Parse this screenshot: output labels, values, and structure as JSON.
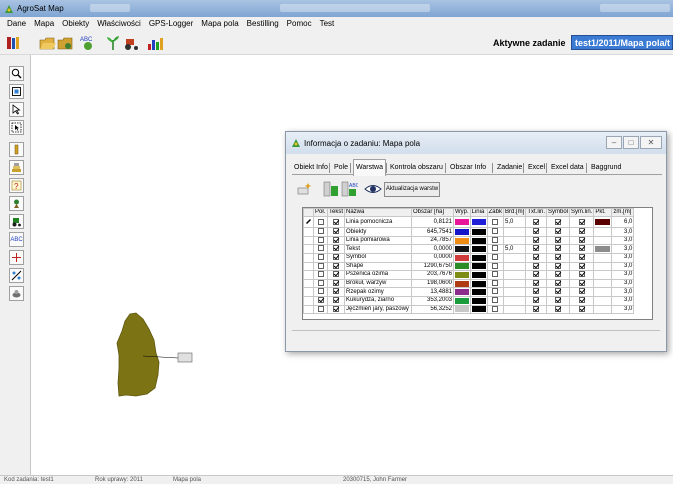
{
  "window": {
    "title": "AgroSat Map"
  },
  "menu": [
    "Dane",
    "Mapa",
    "Obiekty",
    "Właściwości",
    "GPS-Logger",
    "Mapa pola",
    "Bestilling",
    "Pomoc",
    "Test"
  ],
  "toolbar": {
    "active_task_label": "Aktywne zadanie",
    "active_task_value": "test1/2011/Mapa pola/t"
  },
  "left_tools": [
    "zoom-icon",
    "zoom-extent-icon",
    "select-arrow-icon",
    "select-region-icon",
    "measure-icon",
    "layer-icon",
    "info-icon",
    "gps-icon",
    "tractor-icon",
    "text-label-icon",
    "vertex-icon",
    "split-icon",
    "soil-icon"
  ],
  "left_tool_abc_label": "ABC",
  "map": {
    "field_label": ""
  },
  "dialog": {
    "title": "Informacja o zadaniu: Mapa pola",
    "tabs": [
      "Obiekt Info",
      "Pole",
      "Warstwa",
      "Kontrola obszaru",
      "Obszar Info",
      "Zadanie",
      "Excel",
      "Excel data",
      "Baggrund"
    ],
    "active_tab": "Warstwa",
    "update_button": "Aktualizacja warstw",
    "columns": [
      "Poł.",
      "Tekst",
      "Nazwa",
      "Obszar [ha]",
      "Wyp.",
      "Linia",
      "Zabk",
      "Brd.[m]",
      "Txt.lin.",
      "Symbol",
      "Sym.lin.",
      "Pkt.",
      "zm.[m]"
    ],
    "rows": [
      {
        "pol": false,
        "tekst": true,
        "name": "Linia pomocnicza",
        "area": "0,8121",
        "fill": "#e8149a",
        "line": "#1f1fd8",
        "zabk": false,
        "brd": "5,0",
        "txt": true,
        "sym": true,
        "symlin": true,
        "pkt": "#5a0000",
        "zm": "6,0",
        "selected": true
      },
      {
        "pol": false,
        "tekst": true,
        "name": "Obiekty",
        "area": "645,7541",
        "fill": "#1414c8",
        "line": "#000000",
        "zabk": false,
        "brd": "",
        "txt": true,
        "sym": true,
        "symlin": true,
        "pkt": "",
        "zm": "3,0",
        "selected": false
      },
      {
        "pol": false,
        "tekst": true,
        "name": "Linia pomiarowa",
        "area": "24,7857",
        "fill": "#f08c14",
        "line": "#000000",
        "zabk": false,
        "brd": "",
        "txt": true,
        "sym": true,
        "symlin": true,
        "pkt": "",
        "zm": "3,0",
        "selected": false
      },
      {
        "pol": false,
        "tekst": true,
        "name": "Tekst",
        "area": "0,0000",
        "fill": "#141414",
        "line": "#000000",
        "zabk": false,
        "brd": "5,0",
        "txt": true,
        "sym": true,
        "symlin": true,
        "pkt": "#8c8c8c",
        "zm": "3,0",
        "selected": false
      },
      {
        "pol": false,
        "tekst": true,
        "name": "Symbol",
        "area": "0,0000",
        "fill": "#d03c3c",
        "line": "#000000",
        "zabk": false,
        "brd": "",
        "txt": true,
        "sym": true,
        "symlin": true,
        "pkt": "",
        "zm": "3,0",
        "selected": false
      },
      {
        "pol": false,
        "tekst": true,
        "name": "Shape",
        "area": "1290,6750",
        "fill": "#2c8c28",
        "line": "#000000",
        "zabk": false,
        "brd": "",
        "txt": true,
        "sym": true,
        "symlin": true,
        "pkt": "",
        "zm": "3,0",
        "selected": false
      },
      {
        "pol": false,
        "tekst": true,
        "name": "Pszenica ozima",
        "area": "203,7676",
        "fill": "#7c8c14",
        "line": "#000000",
        "zabk": false,
        "brd": "",
        "txt": true,
        "sym": true,
        "symlin": true,
        "pkt": "",
        "zm": "3,0",
        "selected": false
      },
      {
        "pol": false,
        "tekst": true,
        "name": "Brokuł, warzyw",
        "area": "198,0600",
        "fill": "#b03c14",
        "line": "#000000",
        "zabk": false,
        "brd": "",
        "txt": true,
        "sym": true,
        "symlin": true,
        "pkt": "",
        "zm": "3,0",
        "selected": false
      },
      {
        "pol": false,
        "tekst": true,
        "name": "Rzepak ozimy",
        "area": "13,4881",
        "fill": "#8c2c8c",
        "line": "#000000",
        "zabk": false,
        "brd": "",
        "txt": true,
        "sym": true,
        "symlin": true,
        "pkt": "",
        "zm": "3,0",
        "selected": false
      },
      {
        "pol": true,
        "tekst": true,
        "name": "Kukurydza, ziarno",
        "area": "353,2003",
        "fill": "#1a9c3c",
        "line": "#000000",
        "zabk": false,
        "brd": "",
        "txt": true,
        "sym": true,
        "symlin": true,
        "pkt": "",
        "zm": "3,0",
        "selected": false
      },
      {
        "pol": false,
        "tekst": true,
        "name": "Jęczmień jary, paszowy",
        "area": "56,3252",
        "fill": "#c8c8c8",
        "line": "#000000",
        "zabk": false,
        "brd": "",
        "txt": true,
        "sym": true,
        "symlin": true,
        "pkt": "",
        "zm": "3,0",
        "selected": false
      }
    ]
  },
  "status": [
    "Kod zadania: test1",
    "Rok uprawy: 2011",
    "Mapa pola",
    "20300715, John Farmer"
  ],
  "colors": {
    "field": "#7c7414",
    "active_task_bg": "#3b7bd4"
  }
}
